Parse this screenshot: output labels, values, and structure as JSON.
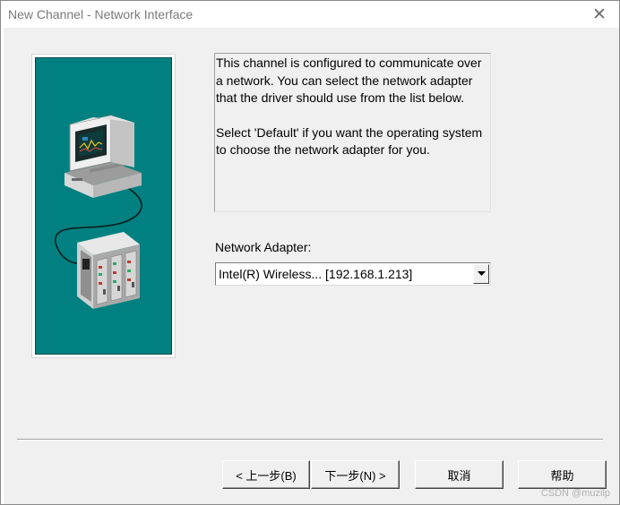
{
  "window": {
    "title": "New Channel - Network Interface",
    "close_glyph": "✕"
  },
  "info": {
    "paragraph1": "This channel is configured to communicate over a network.  You can select the network adapter that the driver should use from the list below.",
    "paragraph2": "Select 'Default' if you want the operating system to choose the network adapter for you."
  },
  "adapter": {
    "label": "Network Adapter:",
    "selected": "Intel(R) Wireless... [192.168.1.213]"
  },
  "buttons": {
    "back": "< 上一步(B)",
    "next": "下一步(N) >",
    "cancel": "取消",
    "help": "帮助"
  },
  "watermark": "CSDN @muzilp",
  "colors": {
    "art_background": "#008080",
    "dialog_background": "#f0f0f0"
  },
  "icons": {
    "computer": "computer-icon",
    "device_rack": "device-rack-icon",
    "dropdown": "chevron-down-icon",
    "close": "close-icon"
  }
}
